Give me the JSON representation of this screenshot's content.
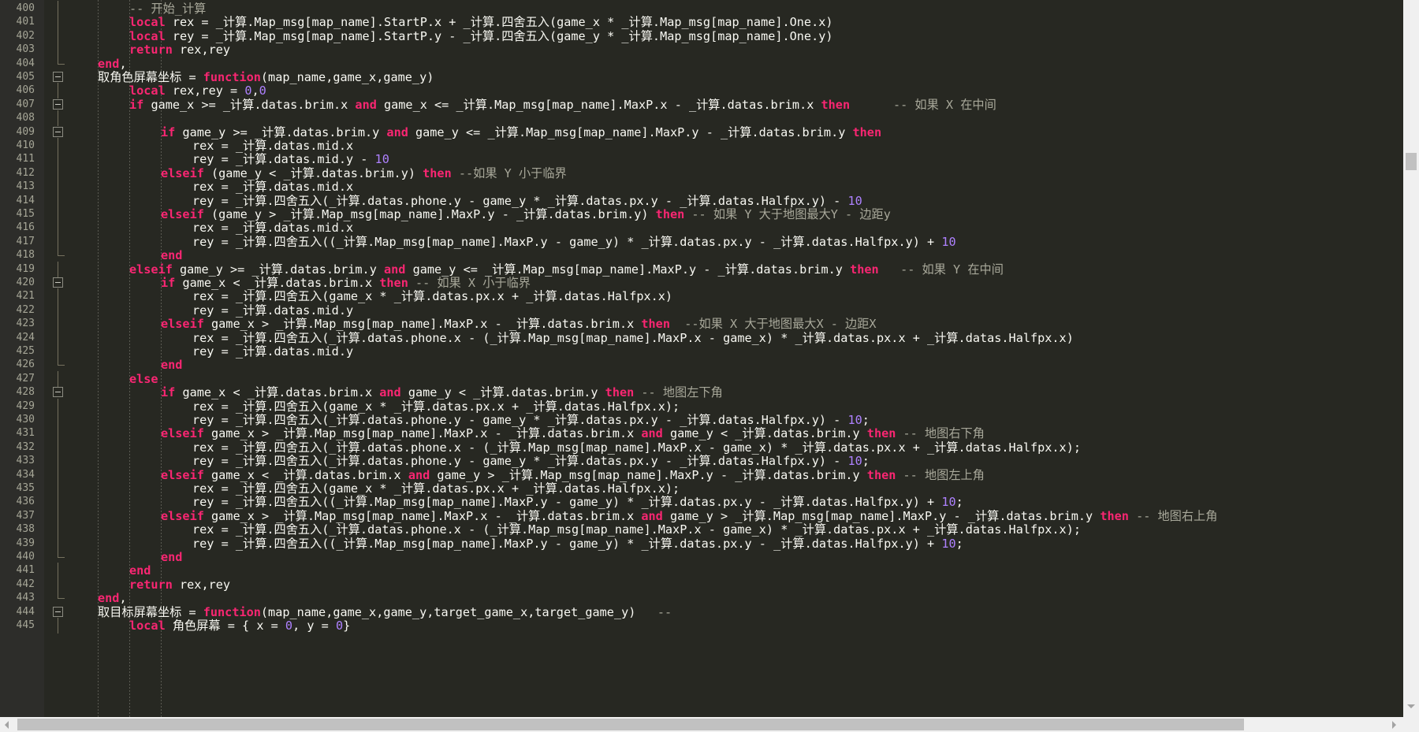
{
  "colors": {
    "background": "#272822",
    "keyword": "#f92672",
    "comment": "#a8a89a",
    "number": "#ae81ff",
    "default_text": "#f8f8f2",
    "line_number": "#a6a697"
  },
  "icons": {
    "fold_marker": "fold-minus-box",
    "scroll_left": "triangle-left",
    "scroll_right": "triangle-right",
    "scroll_down": "triangle-down"
  },
  "lines": [
    {
      "num": "400",
      "fold": "line",
      "indent": 1,
      "tokens": [
        {
          "t": "c",
          "v": "-- 开始_计算"
        }
      ]
    },
    {
      "num": "401",
      "fold": "line",
      "indent": 1,
      "tokens": [
        {
          "t": "k",
          "v": "local"
        },
        {
          "t": "",
          "v": " rex = _计算.Map_msg[map_name].StartP.x + _计算.四舍五入(game_x * _计算.Map_msg[map_name].One.x)"
        }
      ]
    },
    {
      "num": "402",
      "fold": "line",
      "indent": 1,
      "tokens": [
        {
          "t": "k",
          "v": "local"
        },
        {
          "t": "",
          "v": " rey = _计算.Map_msg[map_name].StartP.y - _计算.四舍五入(game_y * _计算.Map_msg[map_name].One.y)"
        }
      ]
    },
    {
      "num": "403",
      "fold": "line",
      "indent": 1,
      "tokens": [
        {
          "t": "k",
          "v": "return"
        },
        {
          "t": "",
          "v": " rex,rey"
        }
      ]
    },
    {
      "num": "404",
      "fold": "end",
      "indent": 0,
      "tokens": [
        {
          "t": "k",
          "v": "end"
        },
        {
          "t": "",
          "v": ","
        }
      ]
    },
    {
      "num": "405",
      "fold": "box",
      "indent": 0,
      "tokens": [
        {
          "t": "",
          "v": "取角色屏幕坐标 = "
        },
        {
          "t": "k",
          "v": "function"
        },
        {
          "t": "",
          "v": "(map_name,game_x,game_y)"
        }
      ]
    },
    {
      "num": "406",
      "fold": "line",
      "indent": 1,
      "tokens": [
        {
          "t": "k",
          "v": "local"
        },
        {
          "t": "",
          "v": " rex,rey = "
        },
        {
          "t": "n",
          "v": "0"
        },
        {
          "t": "",
          "v": ","
        },
        {
          "t": "n",
          "v": "0"
        }
      ]
    },
    {
      "num": "407",
      "fold": "box",
      "indent": 1,
      "tokens": [
        {
          "t": "k",
          "v": "if"
        },
        {
          "t": "",
          "v": " game_x >= _计算.datas.brim.x "
        },
        {
          "t": "k",
          "v": "and"
        },
        {
          "t": "",
          "v": " game_x <= _计算.Map_msg[map_name].MaxP.x - _计算.datas.brim.x "
        },
        {
          "t": "k",
          "v": "then"
        },
        {
          "t": "c",
          "v": "      -- 如果 X 在中间"
        }
      ]
    },
    {
      "num": "408",
      "fold": "line",
      "indent": 0,
      "tokens": []
    },
    {
      "num": "409",
      "fold": "box",
      "indent": 2,
      "tokens": [
        {
          "t": "k",
          "v": "if"
        },
        {
          "t": "",
          "v": " game_y >= _计算.datas.brim.y "
        },
        {
          "t": "k",
          "v": "and"
        },
        {
          "t": "",
          "v": " game_y <= _计算.Map_msg[map_name].MaxP.y - _计算.datas.brim.y "
        },
        {
          "t": "k",
          "v": "then"
        }
      ]
    },
    {
      "num": "410",
      "fold": "line",
      "indent": 3,
      "tokens": [
        {
          "t": "",
          "v": "rex = _计算.datas.mid.x"
        }
      ]
    },
    {
      "num": "411",
      "fold": "line",
      "indent": 3,
      "tokens": [
        {
          "t": "",
          "v": "rey = _计算.datas.mid.y - "
        },
        {
          "t": "n",
          "v": "10"
        }
      ]
    },
    {
      "num": "412",
      "fold": "line",
      "indent": 2,
      "tokens": [
        {
          "t": "k",
          "v": "elseif"
        },
        {
          "t": "",
          "v": " (game_y < _计算.datas.brim.y) "
        },
        {
          "t": "k",
          "v": "then"
        },
        {
          "t": "c",
          "v": " --如果 Y 小于临界"
        }
      ]
    },
    {
      "num": "413",
      "fold": "line",
      "indent": 3,
      "tokens": [
        {
          "t": "",
          "v": "rex = _计算.datas.mid.x"
        }
      ]
    },
    {
      "num": "414",
      "fold": "line",
      "indent": 3,
      "tokens": [
        {
          "t": "",
          "v": "rey = _计算.四舍五入(_计算.datas.phone.y - game_y * _计算.datas.px.y - _计算.datas.Halfpx.y) - "
        },
        {
          "t": "n",
          "v": "10"
        }
      ]
    },
    {
      "num": "415",
      "fold": "line",
      "indent": 2,
      "tokens": [
        {
          "t": "k",
          "v": "elseif"
        },
        {
          "t": "",
          "v": " (game_y > _计算.Map_msg[map_name].MaxP.y - _计算.datas.brim.y) "
        },
        {
          "t": "k",
          "v": "then"
        },
        {
          "t": "c",
          "v": " -- 如果 Y 大于地图最大Y - 边距y"
        }
      ]
    },
    {
      "num": "416",
      "fold": "line",
      "indent": 3,
      "tokens": [
        {
          "t": "",
          "v": "rex = _计算.datas.mid.x"
        }
      ]
    },
    {
      "num": "417",
      "fold": "line",
      "indent": 3,
      "tokens": [
        {
          "t": "",
          "v": "rey = _计算.四舍五入((_计算.Map_msg[map_name].MaxP.y - game_y) * _计算.datas.px.y - _计算.datas.Halfpx.y) + "
        },
        {
          "t": "n",
          "v": "10"
        }
      ]
    },
    {
      "num": "418",
      "fold": "end",
      "indent": 2,
      "tokens": [
        {
          "t": "k",
          "v": "end"
        }
      ]
    },
    {
      "num": "419",
      "fold": "line",
      "indent": 1,
      "tokens": [
        {
          "t": "k",
          "v": "elseif"
        },
        {
          "t": "",
          "v": " game_y >= _计算.datas.brim.y "
        },
        {
          "t": "k",
          "v": "and"
        },
        {
          "t": "",
          "v": " game_y <= _计算.Map_msg[map_name].MaxP.y - _计算.datas.brim.y "
        },
        {
          "t": "k",
          "v": "then"
        },
        {
          "t": "c",
          "v": "   -- 如果 Y 在中间"
        }
      ]
    },
    {
      "num": "420",
      "fold": "box",
      "indent": 2,
      "tokens": [
        {
          "t": "k",
          "v": "if"
        },
        {
          "t": "",
          "v": " game_x < _计算.datas.brim.x "
        },
        {
          "t": "k",
          "v": "then"
        },
        {
          "t": "c",
          "v": " -- 如果 X 小于临界"
        }
      ]
    },
    {
      "num": "421",
      "fold": "line",
      "indent": 3,
      "tokens": [
        {
          "t": "",
          "v": "rex = _计算.四舍五入(game_x * _计算.datas.px.x + _计算.datas.Halfpx.x)"
        }
      ]
    },
    {
      "num": "422",
      "fold": "line",
      "indent": 3,
      "tokens": [
        {
          "t": "",
          "v": "rey = _计算.datas.mid.y"
        }
      ]
    },
    {
      "num": "423",
      "fold": "line",
      "indent": 2,
      "tokens": [
        {
          "t": "k",
          "v": "elseif"
        },
        {
          "t": "",
          "v": " game_x > _计算.Map_msg[map_name].MaxP.x - _计算.datas.brim.x "
        },
        {
          "t": "k",
          "v": "then"
        },
        {
          "t": "c",
          "v": "  --如果 X 大于地图最大X - 边距X"
        }
      ]
    },
    {
      "num": "424",
      "fold": "line",
      "indent": 3,
      "tokens": [
        {
          "t": "",
          "v": "rex = _计算.四舍五入(_计算.datas.phone.x - (_计算.Map_msg[map_name].MaxP.x - game_x) * _计算.datas.px.x + _计算.datas.Halfpx.x)"
        }
      ]
    },
    {
      "num": "425",
      "fold": "line",
      "indent": 3,
      "tokens": [
        {
          "t": "",
          "v": "rey = _计算.datas.mid.y"
        }
      ]
    },
    {
      "num": "426",
      "fold": "end",
      "indent": 2,
      "tokens": [
        {
          "t": "k",
          "v": "end"
        }
      ]
    },
    {
      "num": "427",
      "fold": "line",
      "indent": 1,
      "tokens": [
        {
          "t": "k",
          "v": "else"
        }
      ]
    },
    {
      "num": "428",
      "fold": "box",
      "indent": 2,
      "tokens": [
        {
          "t": "k",
          "v": "if"
        },
        {
          "t": "",
          "v": " game_x < _计算.datas.brim.x "
        },
        {
          "t": "k",
          "v": "and"
        },
        {
          "t": "",
          "v": " game_y < _计算.datas.brim.y "
        },
        {
          "t": "k",
          "v": "then"
        },
        {
          "t": "c",
          "v": " -- 地图左下角"
        }
      ]
    },
    {
      "num": "429",
      "fold": "line",
      "indent": 3,
      "tokens": [
        {
          "t": "",
          "v": "rex = _计算.四舍五入(game_x * _计算.datas.px.x + _计算.datas.Halfpx.x);"
        }
      ]
    },
    {
      "num": "430",
      "fold": "line",
      "indent": 3,
      "tokens": [
        {
          "t": "",
          "v": "rey = _计算.四舍五入(_计算.datas.phone.y - game_y * _计算.datas.px.y - _计算.datas.Halfpx.y) - "
        },
        {
          "t": "n",
          "v": "10"
        },
        {
          "t": "",
          "v": ";"
        }
      ]
    },
    {
      "num": "431",
      "fold": "line",
      "indent": 2,
      "tokens": [
        {
          "t": "k",
          "v": "elseif"
        },
        {
          "t": "",
          "v": " game_x > _计算.Map_msg[map_name].MaxP.x - _计算.datas.brim.x "
        },
        {
          "t": "k",
          "v": "and"
        },
        {
          "t": "",
          "v": " game_y < _计算.datas.brim.y "
        },
        {
          "t": "k",
          "v": "then"
        },
        {
          "t": "c",
          "v": " -- 地图右下角"
        }
      ]
    },
    {
      "num": "432",
      "fold": "line",
      "indent": 3,
      "tokens": [
        {
          "t": "",
          "v": "rex = _计算.四舍五入(_计算.datas.phone.x - (_计算.Map_msg[map_name].MaxP.x - game_x) * _计算.datas.px.x + _计算.datas.Halfpx.x);"
        }
      ]
    },
    {
      "num": "433",
      "fold": "line",
      "indent": 3,
      "tokens": [
        {
          "t": "",
          "v": "rey = _计算.四舍五入(_计算.datas.phone.y - game_y * _计算.datas.px.y - _计算.datas.Halfpx.y) - "
        },
        {
          "t": "n",
          "v": "10"
        },
        {
          "t": "",
          "v": ";"
        }
      ]
    },
    {
      "num": "434",
      "fold": "line",
      "indent": 2,
      "tokens": [
        {
          "t": "k",
          "v": "elseif"
        },
        {
          "t": "",
          "v": " game_x < _计算.datas.brim.x "
        },
        {
          "t": "k",
          "v": "and"
        },
        {
          "t": "",
          "v": " game_y > _计算.Map_msg[map_name].MaxP.y - _计算.datas.brim.y "
        },
        {
          "t": "k",
          "v": "then"
        },
        {
          "t": "c",
          "v": " -- 地图左上角"
        }
      ]
    },
    {
      "num": "435",
      "fold": "line",
      "indent": 3,
      "tokens": [
        {
          "t": "",
          "v": "rex = _计算.四舍五入(game_x * _计算.datas.px.x + _计算.datas.Halfpx.x);"
        }
      ]
    },
    {
      "num": "436",
      "fold": "line",
      "indent": 3,
      "tokens": [
        {
          "t": "",
          "v": "rey = _计算.四舍五入((_计算.Map_msg[map_name].MaxP.y - game_y) * _计算.datas.px.y - _计算.datas.Halfpx.y) + "
        },
        {
          "t": "n",
          "v": "10"
        },
        {
          "t": "",
          "v": ";"
        }
      ]
    },
    {
      "num": "437",
      "fold": "line",
      "indent": 2,
      "tokens": [
        {
          "t": "k",
          "v": "elseif"
        },
        {
          "t": "",
          "v": " game_x > _计算.Map_msg[map_name].MaxP.x - _计算.datas.brim.x "
        },
        {
          "t": "k",
          "v": "and"
        },
        {
          "t": "",
          "v": " game_y > _计算.Map_msg[map_name].MaxP.y - _计算.datas.brim.y "
        },
        {
          "t": "k",
          "v": "then"
        },
        {
          "t": "c",
          "v": " -- 地图右上角"
        }
      ]
    },
    {
      "num": "438",
      "fold": "line",
      "indent": 3,
      "tokens": [
        {
          "t": "",
          "v": "rex = _计算.四舍五入(_计算.datas.phone.x - (_计算.Map_msg[map_name].MaxP.x - game_x) * _计算.datas.px.x + _计算.datas.Halfpx.x);"
        }
      ]
    },
    {
      "num": "439",
      "fold": "line",
      "indent": 3,
      "tokens": [
        {
          "t": "",
          "v": "rey = _计算.四舍五入((_计算.Map_msg[map_name].MaxP.y - game_y) * _计算.datas.px.y - _计算.datas.Halfpx.y) + "
        },
        {
          "t": "n",
          "v": "10"
        },
        {
          "t": "",
          "v": ";"
        }
      ]
    },
    {
      "num": "440",
      "fold": "end",
      "indent": 2,
      "tokens": [
        {
          "t": "k",
          "v": "end"
        }
      ]
    },
    {
      "num": "441",
      "fold": "line",
      "indent": 1,
      "tokens": [
        {
          "t": "k",
          "v": "end"
        }
      ]
    },
    {
      "num": "442",
      "fold": "line",
      "indent": 1,
      "tokens": [
        {
          "t": "k",
          "v": "return"
        },
        {
          "t": "",
          "v": " rex,rey"
        }
      ]
    },
    {
      "num": "443",
      "fold": "end",
      "indent": 0,
      "tokens": [
        {
          "t": "k",
          "v": "end"
        },
        {
          "t": "",
          "v": ","
        }
      ]
    },
    {
      "num": "444",
      "fold": "box",
      "indent": 0,
      "tokens": [
        {
          "t": "",
          "v": "取目标屏幕坐标 = "
        },
        {
          "t": "k",
          "v": "function"
        },
        {
          "t": "",
          "v": "(map_name,game_x,game_y,target_game_x,target_game_y)"
        },
        {
          "t": "c",
          "v": "   --"
        }
      ]
    },
    {
      "num": "445",
      "fold": "line",
      "indent": 1,
      "tokens": [
        {
          "t": "k",
          "v": "local"
        },
        {
          "t": "",
          "v": " 角色屏幕 = { x = "
        },
        {
          "t": "n",
          "v": "0"
        },
        {
          "t": "",
          "v": ", y = "
        },
        {
          "t": "n",
          "v": "0"
        },
        {
          "t": "",
          "v": "}"
        }
      ]
    }
  ]
}
